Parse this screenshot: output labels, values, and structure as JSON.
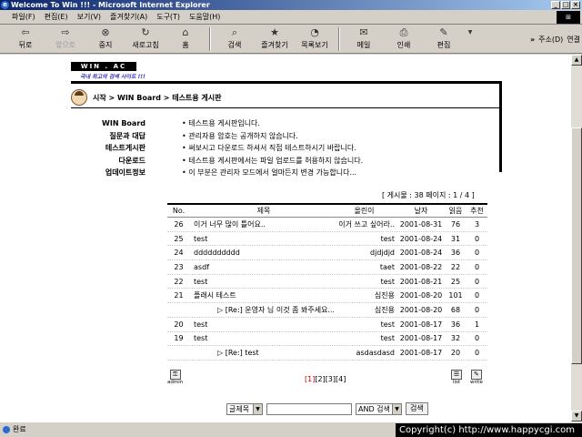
{
  "window": {
    "title": "Welcome To Win !!! - Microsoft Internet Explorer"
  },
  "menu": [
    "파일(F)",
    "편집(E)",
    "보기(V)",
    "즐겨찾기(A)",
    "도구(T)",
    "도움말(H)"
  ],
  "toolbar": {
    "back": "뒤로",
    "forward": "앞으로",
    "stop": "중지",
    "refresh": "새로고침",
    "home": "홈",
    "search": "검색",
    "favorites": "즐겨찾기",
    "history": "목록보기",
    "mail": "메일",
    "print": "인쇄",
    "edit": "편집",
    "address_label": "주소(D)",
    "links_label": "연결"
  },
  "site": {
    "logo": "WIN . AC",
    "tagline": "국내 최고의 검색 사이트 !!!",
    "breadcrumb": "시작 > WIN Board > 테스트용 게시판"
  },
  "info": [
    {
      "key": "WIN Board",
      "value": "테스트용 게시판입니다."
    },
    {
      "key": "질문과 대답",
      "value": "관리자용 암호는 공개하지 않습니다."
    },
    {
      "key": "테스트게시판",
      "value": "써보시고 다운로드 하셔서 직접 테스트하시기 바랍니다."
    },
    {
      "key": "다운로드",
      "value": "테스트용 게시판에서는 파일 업로드를 허용하지 않습니다."
    },
    {
      "key": "업데이트정보",
      "value": "이 부분은 관리자 모드에서 얼마든지 변경 가능합니다..."
    }
  ],
  "board": {
    "summary": "[ 게시물 : 38    페이지 : 1 / 4 ]",
    "headers": {
      "no": "No.",
      "title": "제목",
      "author": "올린이",
      "date": "날자",
      "read": "읽음",
      "rec": "추천"
    },
    "rows": [
      {
        "no": "26",
        "title": "이거 너무 많이 틀어요..",
        "author": "이거 쓰고 싶어라..",
        "date": "2001-08-31",
        "read": "76",
        "rec": "3",
        "reply": false
      },
      {
        "no": "25",
        "title": "test",
        "author": "test",
        "date": "2001-08-24",
        "read": "31",
        "rec": "0",
        "reply": false
      },
      {
        "no": "24",
        "title": "dddddddddd",
        "author": "djdjdjd",
        "date": "2001-08-24",
        "read": "36",
        "rec": "0",
        "reply": false
      },
      {
        "no": "23",
        "title": "asdf",
        "author": "taet",
        "date": "2001-08-22",
        "read": "22",
        "rec": "0",
        "reply": false
      },
      {
        "no": "22",
        "title": "test",
        "author": "test",
        "date": "2001-08-21",
        "read": "25",
        "rec": "0",
        "reply": false
      },
      {
        "no": "21",
        "title": "플래시 테스트",
        "author": "심진용",
        "date": "2001-08-20",
        "read": "101",
        "rec": "0",
        "reply": false
      },
      {
        "no": "",
        "title": "[Re:] 운영자 님 이것 좀 봐주세요.....",
        "author": "심진용",
        "date": "2001-08-20",
        "read": "68",
        "rec": "0",
        "reply": true
      },
      {
        "no": "20",
        "title": "test",
        "author": "test",
        "date": "2001-08-17",
        "read": "36",
        "rec": "1",
        "reply": false
      },
      {
        "no": "19",
        "title": "test",
        "author": "test",
        "date": "2001-08-17",
        "read": "32",
        "rec": "0",
        "reply": false
      },
      {
        "no": "",
        "title": "[Re:] test",
        "author": "asdasdasd",
        "date": "2001-08-17",
        "read": "20",
        "rec": "0",
        "reply": true
      }
    ],
    "pages": [
      "[1]",
      "[2]",
      "[3]",
      "[4]"
    ],
    "current_page": "[1]",
    "admin_label": "admin",
    "list_label": "list",
    "write_label": "write"
  },
  "search": {
    "field_select": "글제목",
    "mode_select": "AND 검색",
    "button": "검색"
  },
  "status": {
    "text": "완료",
    "copyright": "Copyright(c) http://www.happycgi.com"
  }
}
